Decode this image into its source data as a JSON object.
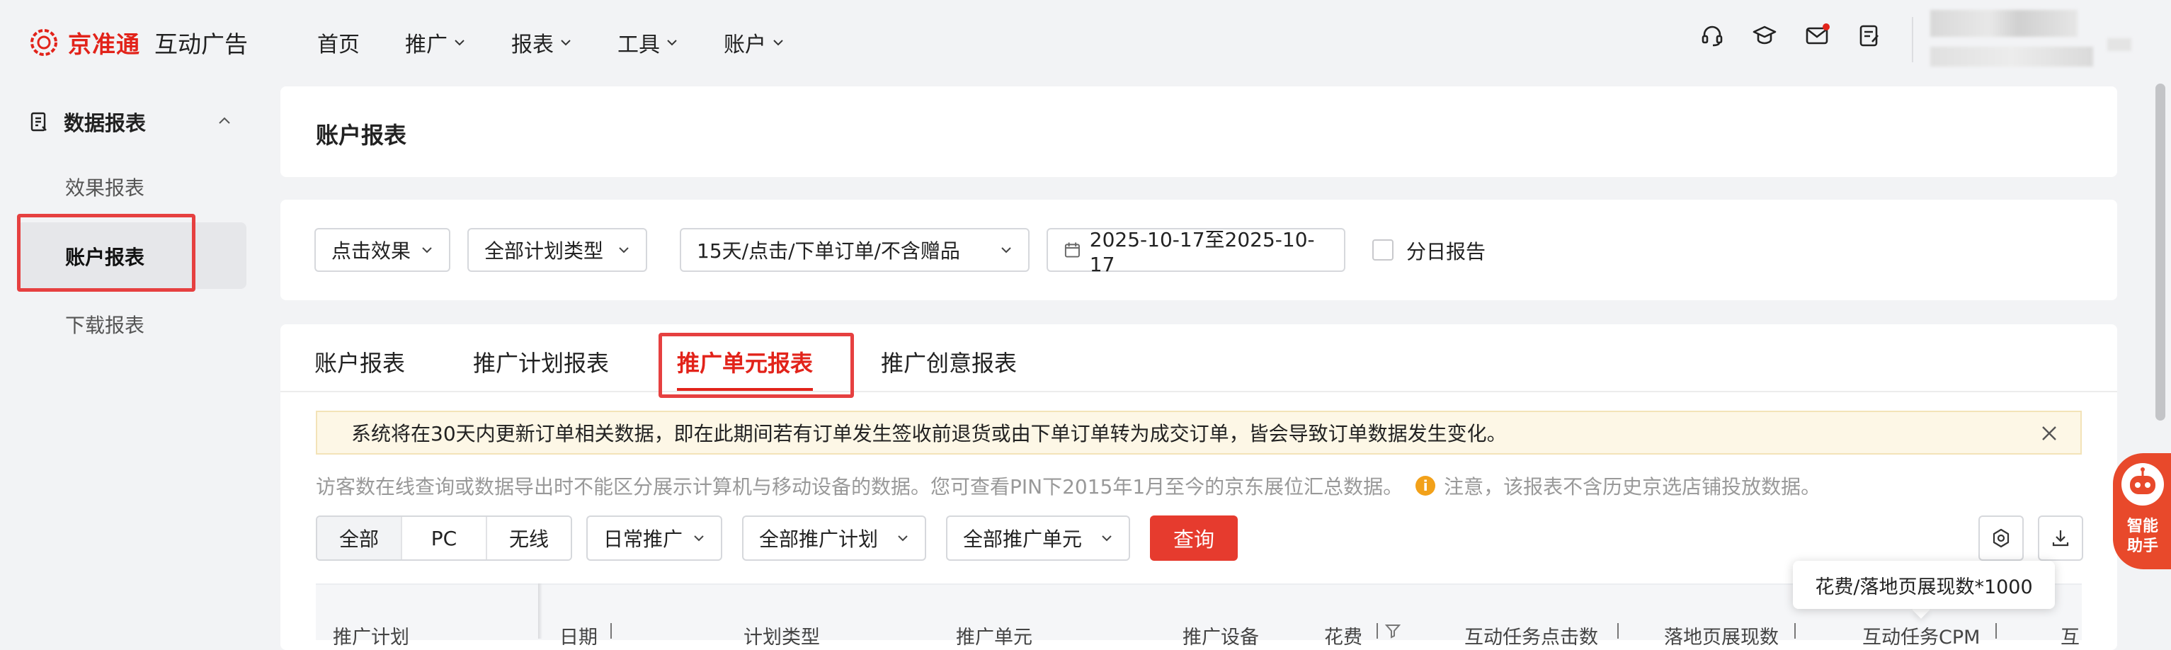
{
  "brand": {
    "name": "京准通",
    "product": "互动广告",
    "color": "#e2231a"
  },
  "nav": {
    "items": [
      {
        "label": "首页",
        "has_menu": false
      },
      {
        "label": "推广",
        "has_menu": true
      },
      {
        "label": "报表",
        "has_menu": true
      },
      {
        "label": "工具",
        "has_menu": true
      },
      {
        "label": "账户",
        "has_menu": true
      }
    ],
    "icons": [
      "headset-icon",
      "graduation-cap-icon",
      "mail-icon",
      "notes-icon"
    ]
  },
  "sidebar": {
    "group_title": "数据报表",
    "items": [
      {
        "label": "效果报表",
        "active": false
      },
      {
        "label": "账户报表",
        "active": true
      },
      {
        "label": "下载报表",
        "active": false
      }
    ]
  },
  "page": {
    "title": "账户报表"
  },
  "filters": {
    "effect": "点击效果",
    "plan_type": "全部计划类型",
    "attribution": "15天/点击/下单订单/不含赠品",
    "date_range": "2025-10-17至2025-10-17",
    "daily_report_label": "分日报告",
    "daily_report_checked": false
  },
  "tabs": [
    {
      "label": "账户报表",
      "active": false
    },
    {
      "label": "推广计划报表",
      "active": false
    },
    {
      "label": "推广单元报表",
      "active": true
    },
    {
      "label": "推广创意报表",
      "active": false
    }
  ],
  "notice": "系统将在30天内更新订单相关数据，即在此期间若有订单发生签收前退货或由下单订单转为成交订单，皆会导致订单数据发生变化。",
  "info": {
    "text": "访客数在线查询或数据导出时不能区分展示计算机与移动设备的数据。您可查看PIN下2015年1月至今的京东展位汇总数据。",
    "warn_icon": "i",
    "warn": "注意，该报表不含历史京选店铺投放数据。"
  },
  "toolbar": {
    "segments": [
      {
        "label": "全部",
        "active": true
      },
      {
        "label": "PC",
        "active": false
      },
      {
        "label": "无线",
        "active": false
      }
    ],
    "promo_type": "日常推广",
    "plan": "全部推广计划",
    "unit": "全部推广单元",
    "query": "查询"
  },
  "table": {
    "columns": [
      "推广计划",
      "日期",
      "计划类型",
      "推广单元",
      "推广设备",
      "花费",
      "互动任务点击数",
      "落地页展现数",
      "互动任务CPM",
      "互"
    ]
  },
  "tooltip": "花费/落地页展现数*1000",
  "assistant": {
    "label": "智能助手"
  }
}
